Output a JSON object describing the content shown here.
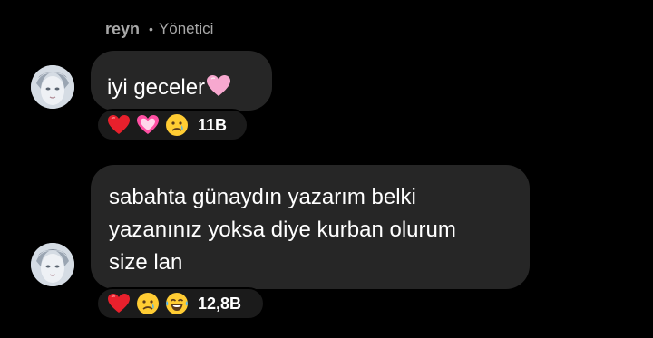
{
  "sender": {
    "name": "reyn",
    "separator": "•",
    "role": "Yönetici"
  },
  "messages": [
    {
      "text": "iyi geceler",
      "trailing_icon": "pink-heart-icon",
      "reactions": [
        "red-heart-icon",
        "sparkling-heart-icon",
        "crying-face-icon"
      ],
      "reaction_count": "11B"
    },
    {
      "lines": [
        "sabahta günaydın yazarım belki",
        "yazanınız yoksa diye kurban olurum",
        "size lan"
      ],
      "reactions": [
        "red-heart-icon",
        "crying-face-icon",
        "tears-of-joy-icon"
      ],
      "reaction_count": "12,8B"
    }
  ],
  "colors": {
    "background": "#000000",
    "bubble": "#262626",
    "reaction_pill": "#1b1b1b",
    "meta_text": "#a8a8a8"
  }
}
